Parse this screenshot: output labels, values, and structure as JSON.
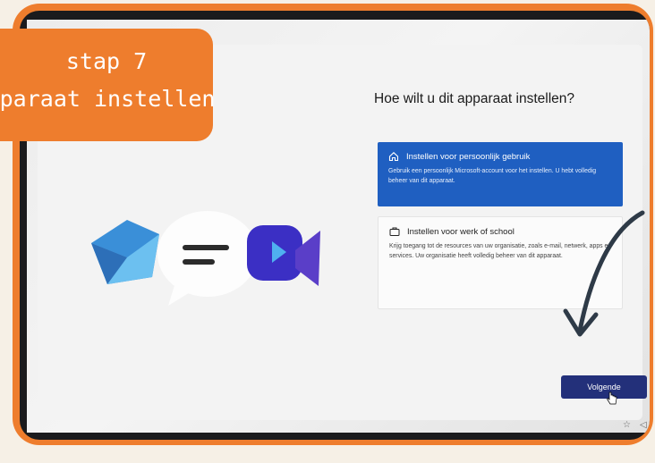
{
  "badge": {
    "line1": "Stap 7",
    "line2": "apparaat instellen"
  },
  "setup": {
    "heading": "Hoe wilt u dit apparaat instellen?",
    "options": [
      {
        "title": "Instellen voor persoonlijk gebruik",
        "description": "Gebruik een persoonlijk Microsoft-account voor het instellen. U hebt volledig beheer van dit apparaat.",
        "icon": "home-icon",
        "selected": true
      },
      {
        "title": "Instellen voor werk of school",
        "description": "Krijg toegang tot de resources van uw organisatie, zoals e-mail, netwerk, apps en services. Uw organisatie heeft volledig beheer van dit apparaat.",
        "icon": "briefcase-icon",
        "selected": false
      }
    ],
    "next_label": "Volgende"
  },
  "colors": {
    "accent_orange": "#ee7d2d",
    "selected_option": "#1f5fc1",
    "next_button": "#23307a"
  }
}
